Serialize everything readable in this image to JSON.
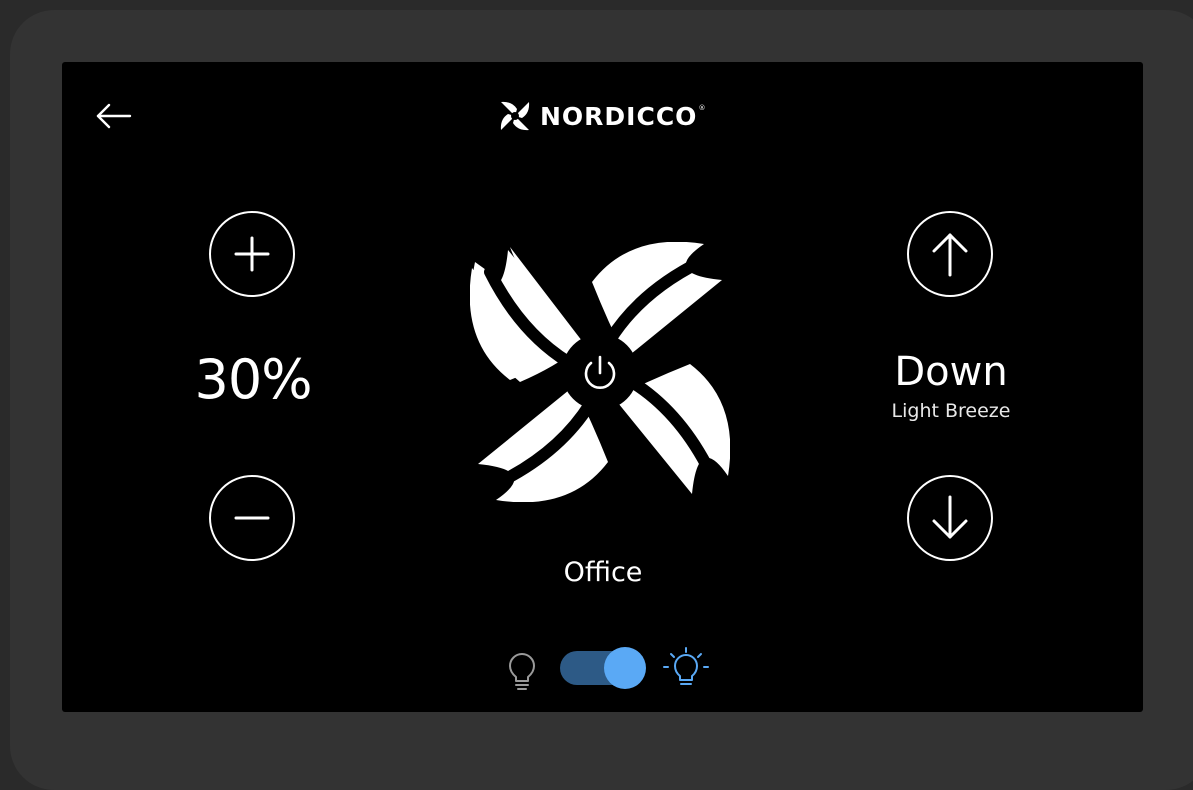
{
  "brand": {
    "name": "NORDICCO",
    "registered_mark": "®",
    "logo_icon": "pinwheel-logo-icon"
  },
  "navigation": {
    "back_icon": "arrow-left-icon"
  },
  "speed": {
    "value_label": "30%",
    "level_percent": 30,
    "increase_icon": "plus-icon",
    "decrease_icon": "minus-icon"
  },
  "fan": {
    "room_name": "Office",
    "power_icon": "power-icon",
    "graphic_icon": "fan-blades-icon"
  },
  "direction": {
    "label": "Down",
    "mode": "Light Breeze",
    "up_icon": "arrow-up-icon",
    "down_icon": "arrow-down-icon"
  },
  "light": {
    "enabled": true,
    "off_icon": "lightbulb-off-icon",
    "on_icon": "lightbulb-on-icon"
  },
  "colors": {
    "background": "#000000",
    "bezel": "#333333",
    "foreground": "#ffffff",
    "accent": "#5aa9f5",
    "toggle_track": "#2d5a86",
    "inactive_icon": "#9a9a9a"
  }
}
